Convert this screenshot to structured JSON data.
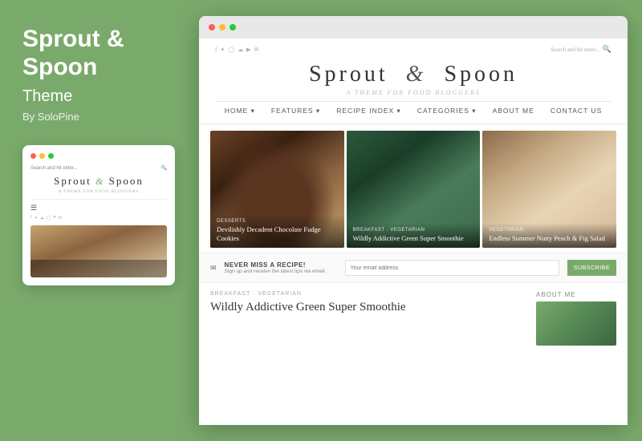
{
  "left": {
    "title": "Sprout &",
    "title2": "Spoon",
    "subtitle": "Theme",
    "by_line": "By SoloPine"
  },
  "mobile": {
    "search_placeholder": "Search and hit enter...",
    "logo_text": "Sprout",
    "amp": "&",
    "logo_text2": "Spoon",
    "tagline": "A THEME FOR FOOD BLOGGERS"
  },
  "browser": {
    "dots": [
      "red",
      "yellow",
      "green"
    ]
  },
  "site": {
    "logo_part1": "Sprout",
    "amp": "&",
    "logo_part2": "Spoon",
    "tagline": "A THEME FOR FOOD BLOGGERS",
    "nav": [
      "HOME",
      "FEATURES",
      "RECIPE INDEX",
      "CATEGORIES",
      "ABOUT ME",
      "CONTACT US"
    ],
    "search_placeholder": "Search and hit enter..."
  },
  "featured": [
    {
      "category": "DESSERTS",
      "title": "Devilishly Decadent Chocolate Fudge Cookies"
    },
    {
      "category": "BREAKFAST · VEGETARIAN",
      "title": "Wildly Addictive Green Super Smoothie"
    },
    {
      "category": "VEGETARIAN",
      "title": "Endless Summer Nutty Peach & Fig Salad"
    }
  ],
  "subscribe": {
    "title": "NEVER MISS A RECIPE!",
    "desc": "Sign up and receive the latest tips via email.",
    "input_placeholder": "Your email address",
    "button_label": "SUBSCRIBE"
  },
  "post": {
    "meta": "BREAKFAST · VEGETARIAN",
    "title": "Wildly Addictive Green Super Smoothie"
  },
  "about_me": {
    "label": "ABOUT ME"
  }
}
